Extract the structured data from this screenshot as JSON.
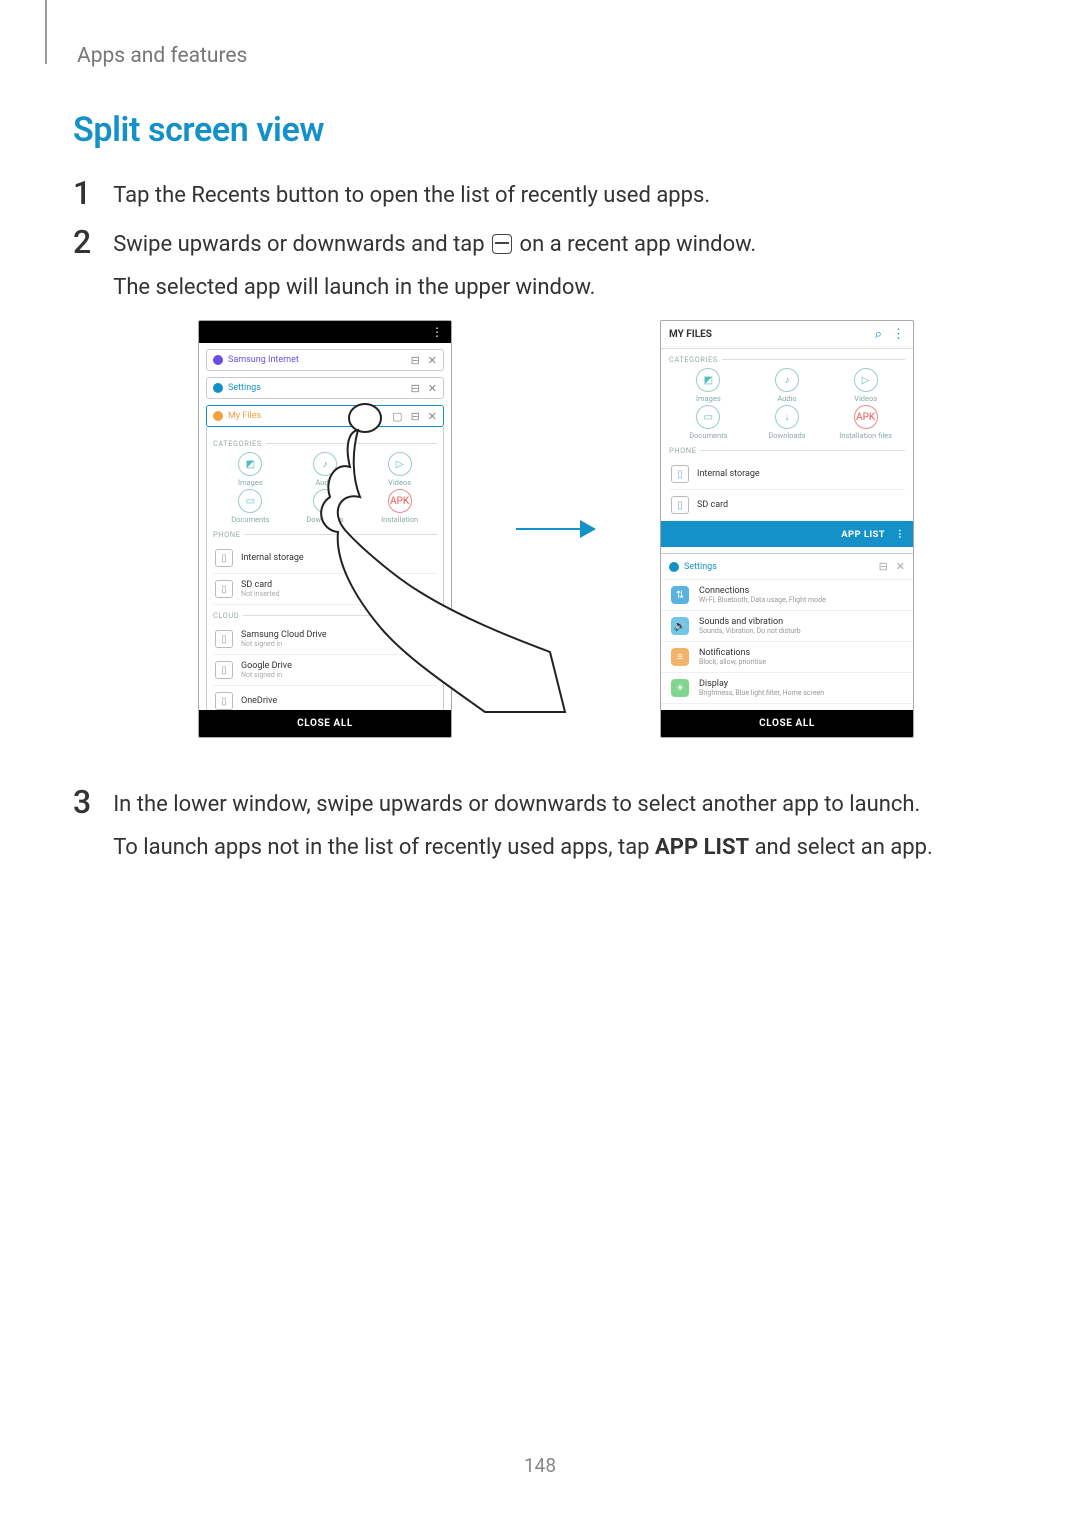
{
  "header": {
    "breadcrumb": "Apps and features"
  },
  "title": "Split screen view",
  "steps": {
    "s1": {
      "num": "1",
      "text": "Tap the Recents button to open the list of recently used apps."
    },
    "s2": {
      "num": "2",
      "line1a": "Swipe upwards or downwards and tap ",
      "line1b": " on a recent app window.",
      "line2": "The selected app will launch in the upper window."
    },
    "s3": {
      "num": "3",
      "line1": "In the lower window, swipe upwards or downwards to select another app to launch.",
      "line2a": "To launch apps not in the list of recently used apps, tap ",
      "line2bold": "APP LIST",
      "line2b": " and select an app."
    }
  },
  "leftPhone": {
    "recents": [
      {
        "label": "Samsung Internet",
        "color": "#6b4de6"
      },
      {
        "label": "Settings",
        "color": "#1591c9"
      },
      {
        "label": "My Files",
        "color": "#f2a23c"
      }
    ],
    "split_icon": "⊟",
    "close_icon": "✕",
    "expand_icon": "▢",
    "sect_categories": "CATEGORIES",
    "categories": [
      {
        "label": "Images",
        "ico": "◩"
      },
      {
        "label": "Audio",
        "ico": "♪"
      },
      {
        "label": "Videos",
        "ico": "▷"
      },
      {
        "label": "Documents",
        "ico": "▭"
      },
      {
        "label": "Downloads",
        "ico": "↓"
      },
      {
        "label": "Installation",
        "ico": "APK",
        "apk": true
      }
    ],
    "sect_phone": "PHONE",
    "phone_rows": [
      {
        "t1": "Internal storage",
        "t2": " "
      },
      {
        "t1": "SD card",
        "t2": "Not inserted"
      }
    ],
    "sect_cloud": "CLOUD",
    "cloud_rows": [
      {
        "t1": "Samsung Cloud Drive",
        "t2": "Not signed in"
      },
      {
        "t1": "Google Drive",
        "t2": "Not signed in"
      },
      {
        "t1": "OneDrive",
        "t2": " "
      }
    ],
    "close_all": "CLOSE ALL"
  },
  "rightPhone": {
    "top_title": "MY FILES",
    "search_icon": "⌕",
    "more_icon": "⋮",
    "sect_categories": "CATEGORIES",
    "categories": [
      {
        "label": "Images",
        "ico": "◩"
      },
      {
        "label": "Audio",
        "ico": "♪"
      },
      {
        "label": "Videos",
        "ico": "▷"
      },
      {
        "label": "Documents",
        "ico": "▭"
      },
      {
        "label": "Downloads",
        "ico": "↓"
      },
      {
        "label": "Installation files",
        "ico": "APK",
        "apk": true
      }
    ],
    "sect_phone": "PHONE",
    "phone_rows": [
      {
        "t1": "Internal storage",
        "t2": " "
      },
      {
        "t1": "SD card",
        "t2": ""
      }
    ],
    "app_list": "APP LIST",
    "settings_label": "Settings",
    "split_icon": "⊟",
    "close_icon": "✕",
    "settings_rows": [
      {
        "t1": "Connections",
        "t2": "Wi-Fi, Bluetooth, Data usage, Flight mode",
        "ico": "⇅",
        "bg": "#58b3e0"
      },
      {
        "t1": "Sounds and vibration",
        "t2": "Sounds, Vibration, Do not disturb",
        "ico": "🔊",
        "bg": "#6fc6e8"
      },
      {
        "t1": "Notifications",
        "t2": "Block, allow, prioritise",
        "ico": "≡",
        "bg": "#f4b36a"
      },
      {
        "t1": "Display",
        "t2": "Brightness, Blue light filter, Home screen",
        "ico": "☀",
        "bg": "#7fd48f"
      }
    ],
    "close_all": "CLOSE ALL"
  },
  "page_number": "148"
}
